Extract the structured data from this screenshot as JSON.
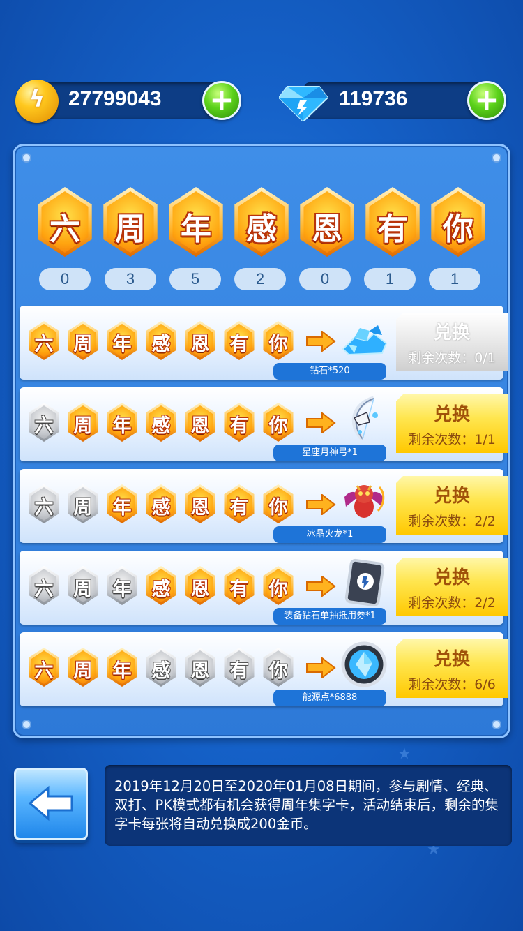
{
  "currency": {
    "coins": {
      "value": "27799043",
      "icon": "coin-icon"
    },
    "diamonds": {
      "value": "119736",
      "icon": "diamond-icon"
    }
  },
  "title_chars": [
    "六",
    "周",
    "年",
    "感",
    "恩",
    "有",
    "你"
  ],
  "card_counts": [
    "0",
    "3",
    "5",
    "2",
    "0",
    "1",
    "1"
  ],
  "exchange_rows": [
    {
      "reward": "钻石*520",
      "reward_icon": "diamond-pile-icon",
      "button": "兑换",
      "remaining": "剩余次数：0/1",
      "enabled": false,
      "collected": [
        1,
        1,
        1,
        1,
        1,
        1,
        1
      ]
    },
    {
      "reward": "星座月神弓*1",
      "reward_icon": "moon-bow-icon",
      "button": "兑换",
      "remaining": "剩余次数：1/1",
      "enabled": true,
      "collected": [
        0,
        1,
        1,
        1,
        1,
        1,
        1
      ]
    },
    {
      "reward": "冰晶火龙*1",
      "reward_icon": "fire-dragon-icon",
      "button": "兑换",
      "remaining": "剩余次数：2/2",
      "enabled": true,
      "collected": [
        0,
        0,
        1,
        1,
        1,
        1,
        1
      ]
    },
    {
      "reward": "装备钻石单抽抵用券*1",
      "reward_icon": "voucher-card-icon",
      "button": "兑换",
      "remaining": "剩余次数：2/2",
      "enabled": true,
      "collected": [
        0,
        0,
        0,
        1,
        1,
        1,
        1
      ]
    },
    {
      "reward": "能源点*6888",
      "reward_icon": "energy-orb-icon",
      "button": "兑换",
      "remaining": "剩余次数：6/6",
      "enabled": true,
      "collected": [
        1,
        1,
        1,
        0,
        0,
        0,
        0
      ]
    }
  ],
  "info_text": "2019年12月20日至2020年01月08日期间，参与剧情、经典、双打、PK模式都有机会获得周年集字卡，活动结束后，剩余的集字卡每张将自动兑换成200金币。",
  "colors": {
    "accent_orange": "#ff9a10",
    "button_yellow": "#ffd820",
    "panel_blue": "#3f8ee8"
  }
}
